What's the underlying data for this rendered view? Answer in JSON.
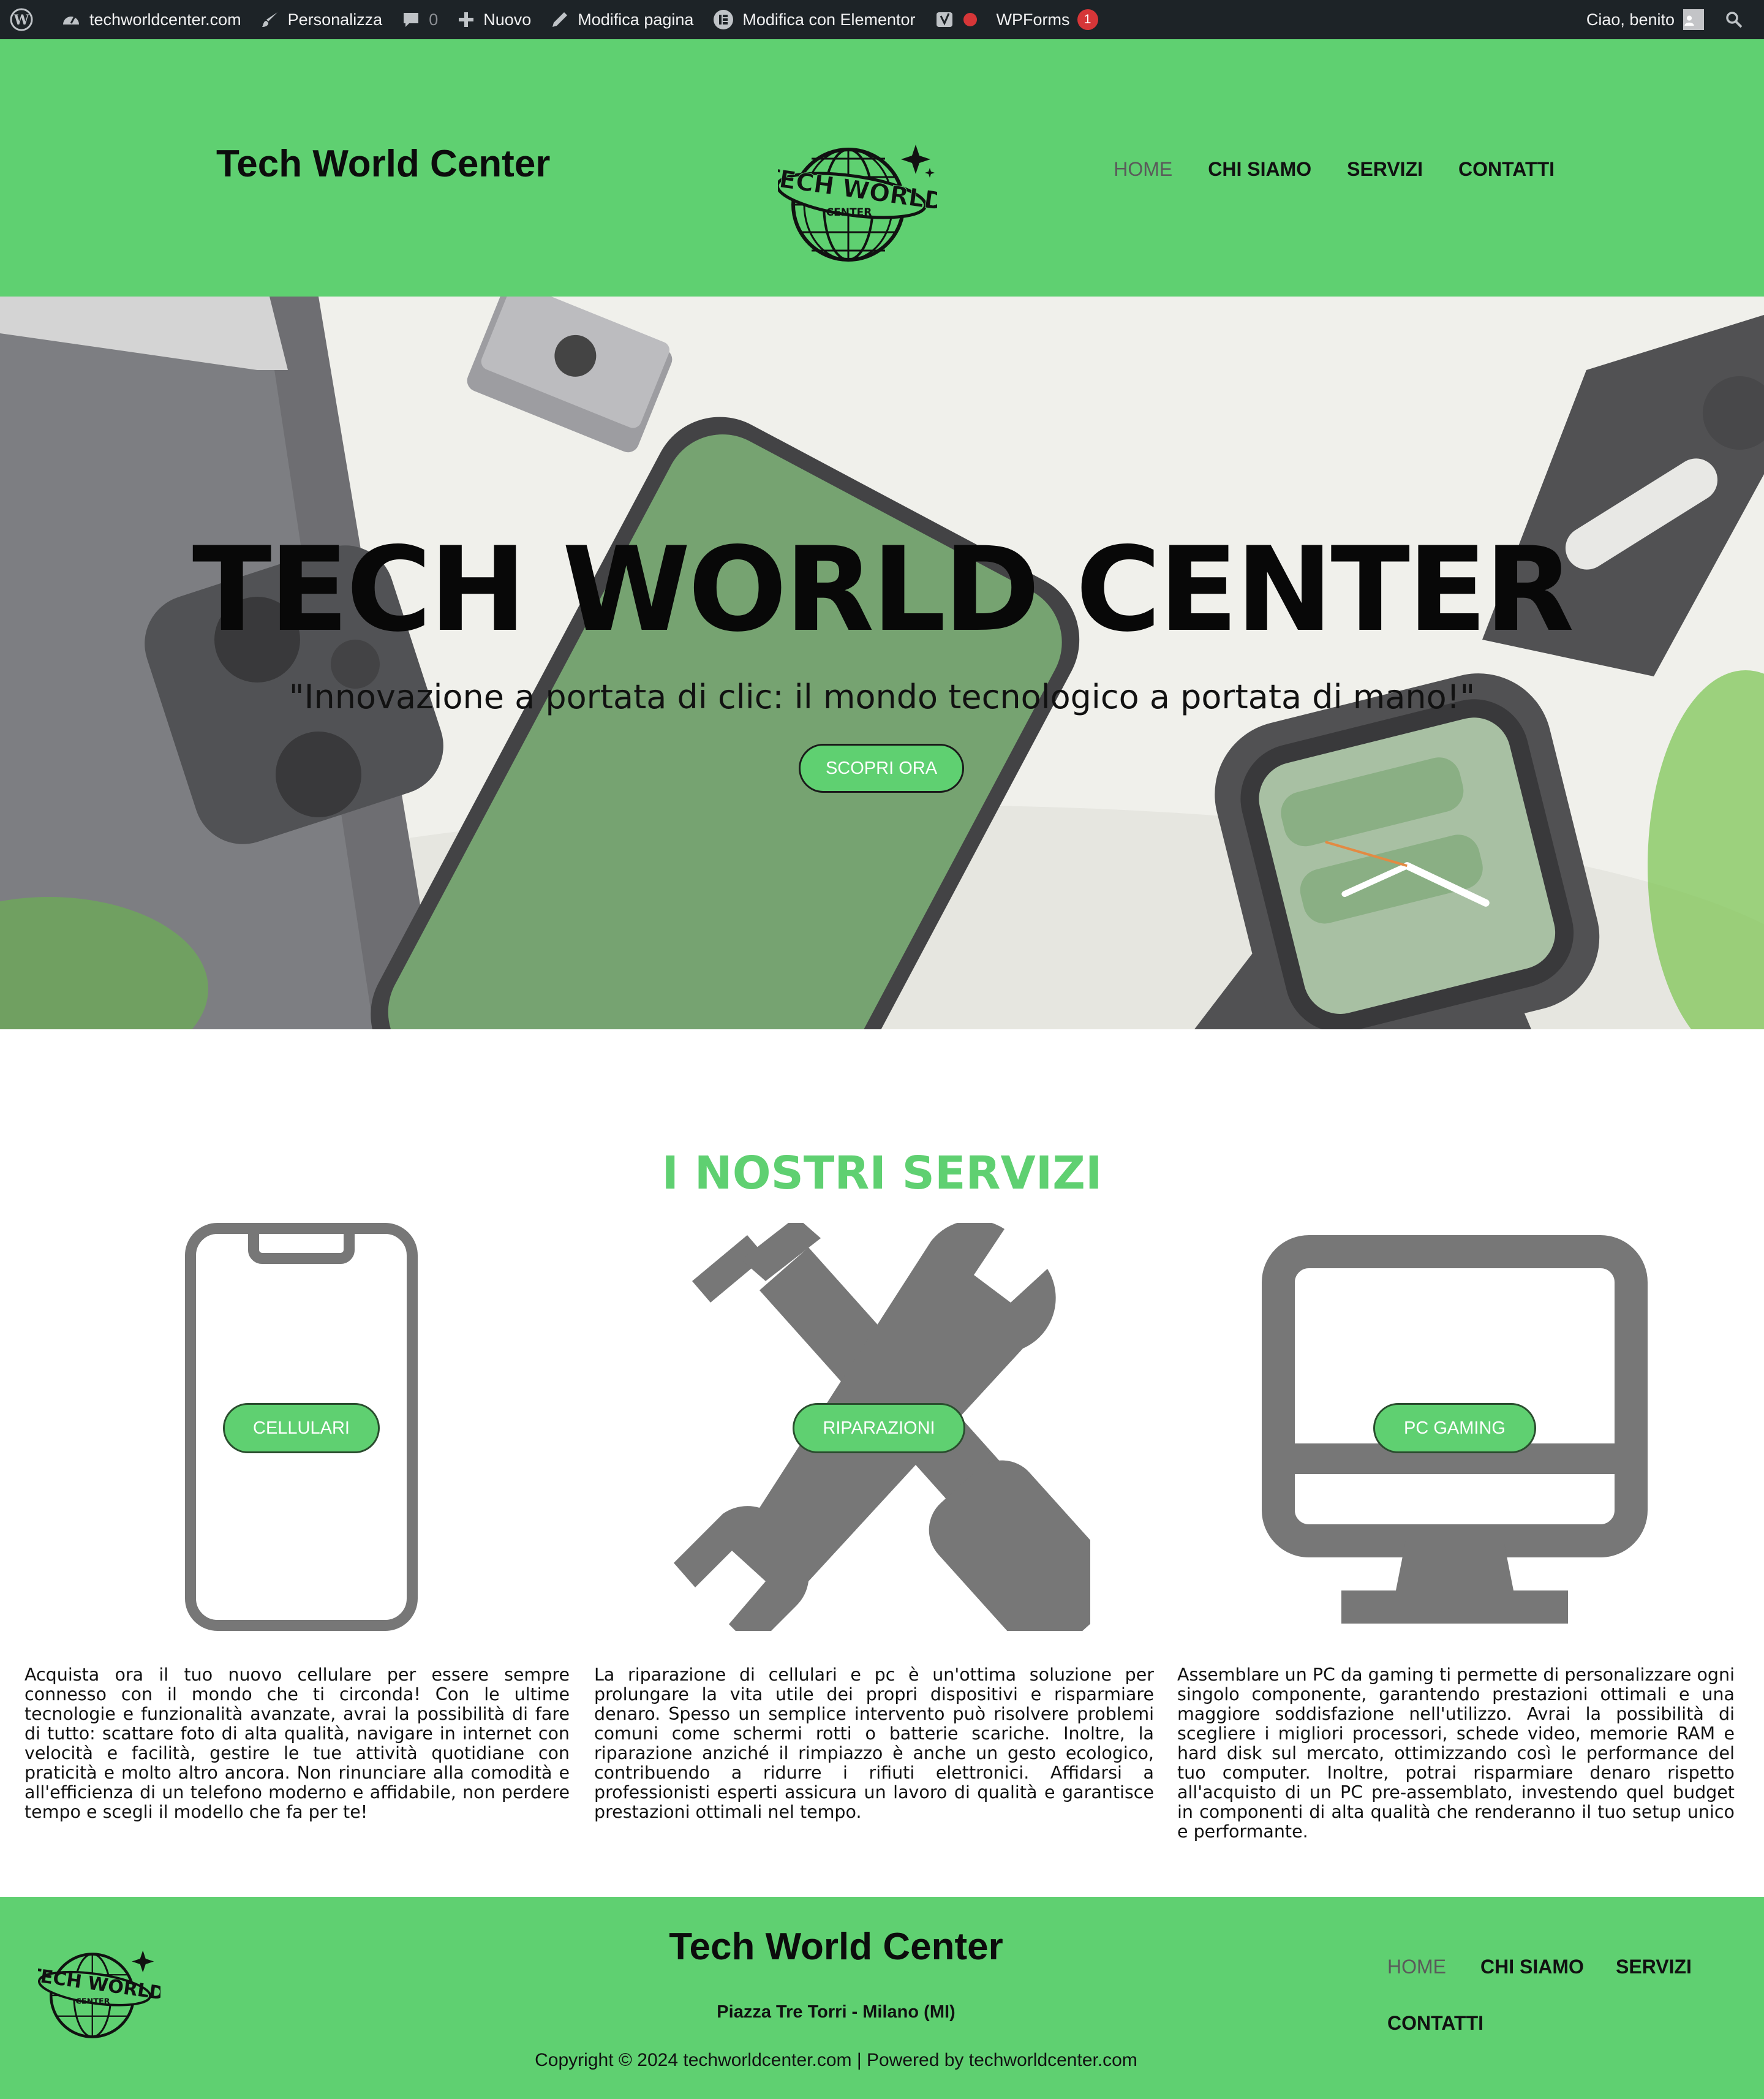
{
  "admin_bar": {
    "site": "techworldcenter.com",
    "customize": "Personalizza",
    "comments": "0",
    "new": "Nuovo",
    "edit_page": "Modifica pagina",
    "elementor": "Modifica con Elementor",
    "wpforms": "WPForms",
    "wpforms_count": "1",
    "greeting": "Ciao, benito"
  },
  "header": {
    "title": "Tech World Center",
    "logo_text_1": "TECH WORLD",
    "logo_text_2": "CENTER",
    "nav": [
      "HOME",
      "CHI SIAMO",
      "SERVIZI",
      "CONTATTI"
    ]
  },
  "hero": {
    "title": "TECH WORLD CENTER",
    "subtitle": "\"Innovazione a portata di clic: il mondo tecnologico a portata di mano!\"",
    "cta": "SCOPRI ORA"
  },
  "services": {
    "title": "I NOSTRI SERVIZI",
    "items": [
      {
        "label": "CELLULARI",
        "text": "Acquista ora il tuo nuovo cellulare per essere sempre connesso con il mondo che ti circonda! Con le ultime tecnologie e funzionalità avanzate, avrai la possibilità di fare di tutto: scattare foto di alta qualità, navigare in internet con velocità e facilità, gestire le tue attività quotidiane con praticità e molto altro ancora. Non rinunciare alla comodità e all'efficienza di un telefono moderno e affidabile, non perdere tempo e scegli il modello che fa per te!"
      },
      {
        "label": "RIPARAZIONI",
        "text": "La riparazione di cellulari e pc è un'ottima soluzione per prolungare la vita utile dei propri dispositivi e risparmiare denaro. Spesso un semplice intervento può risolvere problemi comuni come schermi rotti o batterie scariche. Inoltre, la riparazione anziché il rimpiazzo è anche un gesto ecologico, contribuendo a ridurre i rifiuti elettronici. Affidarsi a professionisti esperti assicura un lavoro di qualità e garantisce prestazioni ottimali nel tempo."
      },
      {
        "label": "PC GAMING",
        "text": "Assemblare un PC da gaming ti permette di personalizzare ogni singolo componente, garantendo prestazioni ottimali e una maggiore soddisfazione nell'utilizzo. Avrai la possibilità di scegliere i migliori processori, schede video, memorie RAM e hard disk sul mercato, ottimizzando così le performance del tuo computer. Inoltre, potrai risparmiare denaro rispetto all'acquisto di un PC pre-assemblato, investendo quel budget in componenti di alta qualità che renderanno il tuo setup unico e performante."
      }
    ]
  },
  "footer": {
    "title": "Tech World Center",
    "address": "Piazza Tre Torri - Milano (MI)",
    "copyright": "Copyright © 2024 techworldcenter.com | Powered by techworldcenter.com",
    "nav": [
      "HOME",
      "CHI SIAMO",
      "SERVIZI",
      "CONTATTI"
    ]
  },
  "colors": {
    "brand_green": "#5fd071",
    "admin_bar": "#1d2327",
    "icon_gray": "#7a7a7a",
    "badge_red": "#d63638"
  }
}
